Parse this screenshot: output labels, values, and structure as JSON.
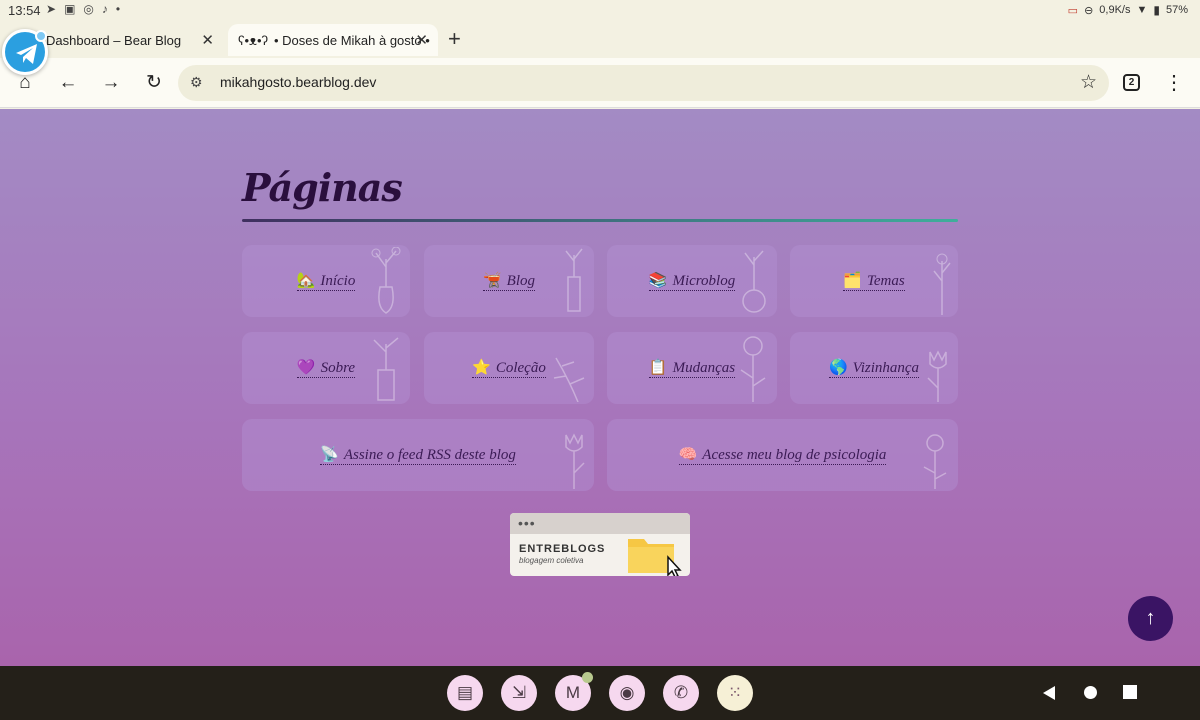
{
  "status_bar": {
    "time": "13:54",
    "network_speed": "0,9K/s",
    "battery": "57%"
  },
  "tabs": [
    {
      "title": "Dashboard – Bear Blog",
      "active": false
    },
    {
      "title": "• Doses de Mikah à gosto •",
      "active": true
    }
  ],
  "toolbar": {
    "url": "mikahgosto.bearblog.dev",
    "tab_count": "2"
  },
  "page": {
    "heading": "Páginas",
    "links": [
      {
        "emoji": "🏡",
        "label": "Início"
      },
      {
        "emoji": "🫕",
        "label": "Blog"
      },
      {
        "emoji": "📚",
        "label": "Microblog"
      },
      {
        "emoji": "🗂️",
        "label": "Temas"
      },
      {
        "emoji": "💜",
        "label": "Sobre"
      },
      {
        "emoji": "⭐",
        "label": "Coleção"
      },
      {
        "emoji": "📋",
        "label": "Mudanças"
      },
      {
        "emoji": "🌎",
        "label": "Vizinhança"
      },
      {
        "emoji": "📡",
        "label": "Assine o feed RSS deste blog"
      },
      {
        "emoji": "🧠",
        "label": "Acesse meu blog de psicologia"
      }
    ],
    "badge": {
      "dots": "•••",
      "title": "ENTREBLOGS",
      "subtitle": "blogagem coletiva"
    },
    "back_to_top": "↑"
  },
  "colors": {
    "heading": "#2a0f3d",
    "accent_rule": "#3fae9b",
    "back_to_top_bg": "#3a1464",
    "taskbar_bg": "#242019"
  }
}
